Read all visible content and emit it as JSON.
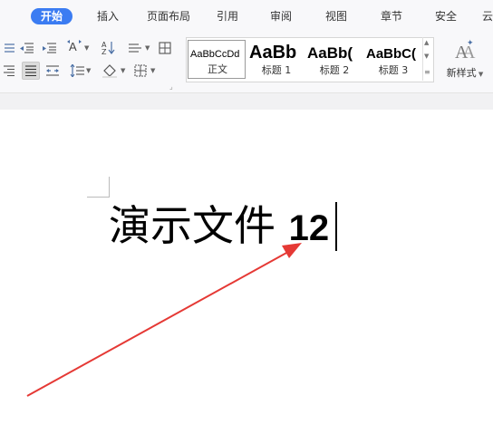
{
  "tabs": [
    "开始",
    "插入",
    "页面布局",
    "引用",
    "审阅",
    "视图",
    "章节",
    "安全",
    "云"
  ],
  "styles": [
    {
      "sample": "AaBbCcDd",
      "name": "正文"
    },
    {
      "sample": "AaBb",
      "name": "标题 1"
    },
    {
      "sample": "AaBb(",
      "name": "标题 2"
    },
    {
      "sample": "AaBbC(",
      "name": "标题 3"
    }
  ],
  "new_style_label": "新样式",
  "document": {
    "text_cjk": "演示文件 ",
    "text_num": "12"
  },
  "colors": {
    "accent": "#3b7cf2",
    "arrow": "#e53935"
  }
}
